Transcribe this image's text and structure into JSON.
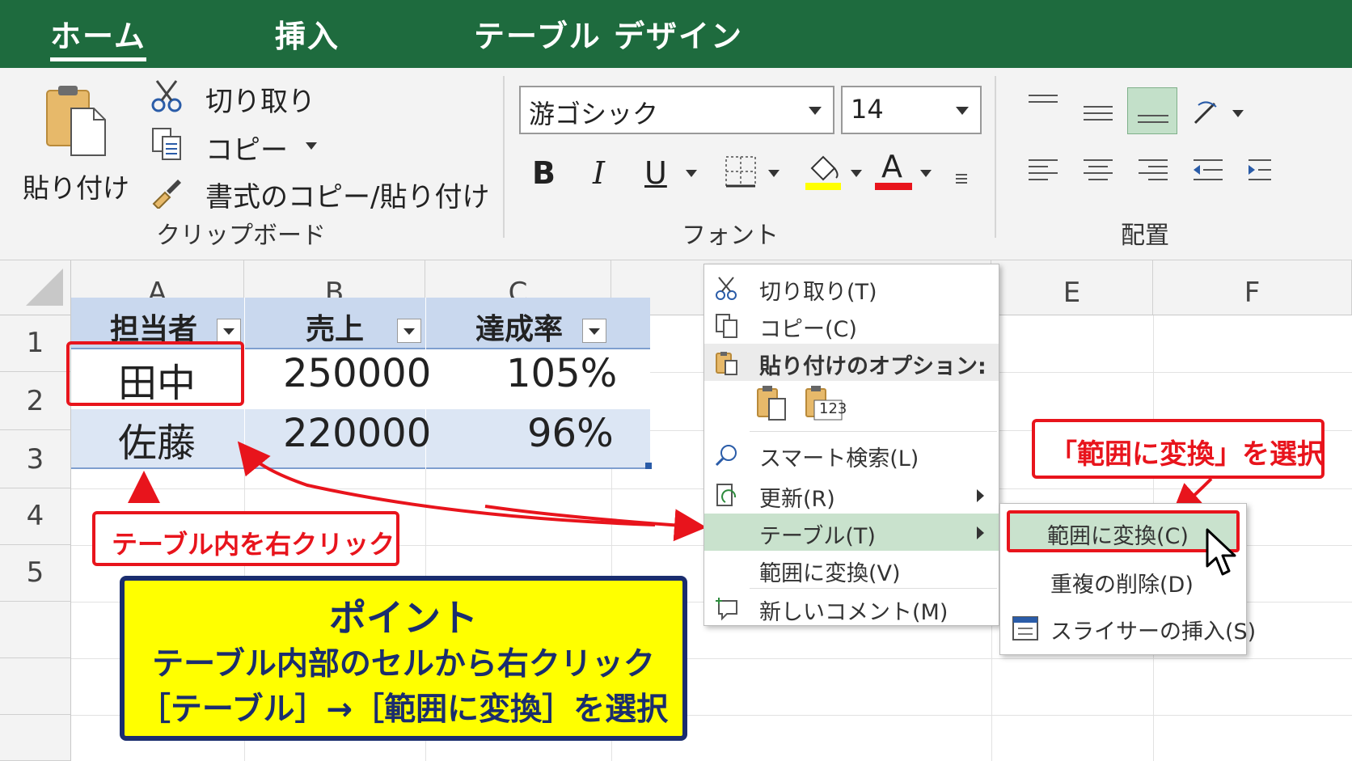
{
  "tabs": [
    {
      "label": "ホーム",
      "active": true
    },
    {
      "label": "挿入",
      "active": false
    },
    {
      "label": "テーブル デザイン",
      "active": false
    }
  ],
  "ribbon": {
    "clipboard": {
      "paste_label": "貼り付け",
      "cut_label": "切り取り",
      "copy_label": "コピー",
      "format_painter_label": "書式のコピー/貼り付け",
      "group_label": "クリップボード"
    },
    "font": {
      "font_name": "游ゴシック",
      "font_size": "14",
      "bold": "B",
      "italic": "I",
      "underline": "U",
      "font_color_glyph": "A",
      "group_label": "フォント",
      "highlight_color": "#ffff00",
      "font_color": "#e8141c"
    },
    "alignment": {
      "group_label": "配置"
    }
  },
  "sheet": {
    "columns": [
      "A",
      "B",
      "C",
      "",
      "E",
      "F"
    ],
    "rows": [
      "1",
      "2",
      "3",
      "4",
      "5"
    ],
    "table_headers": [
      "担当者",
      "売上",
      "達成率"
    ],
    "table_rows": [
      [
        "田中",
        "250000",
        "105%"
      ],
      [
        "佐藤",
        "220000",
        "96%"
      ]
    ],
    "table_header_color": "#c9d8ee",
    "table_band_color": "#dce6f4"
  },
  "context_menu": {
    "items": [
      {
        "label": "切り取り(T)",
        "icon": "scissors-icon"
      },
      {
        "label": "コピー(C)",
        "icon": "copy-icon"
      },
      {
        "label": "貼り付けのオプション:",
        "icon": "paste-icon",
        "header": true
      },
      {
        "label": "スマート検索(L)",
        "icon": "smart-lookup-icon"
      },
      {
        "label": "更新(R)",
        "icon": "refresh-icon",
        "submenu": true
      },
      {
        "label": "テーブル(T)",
        "icon": "",
        "submenu": true,
        "highlighted": true
      },
      {
        "label": "範囲に変換(V)",
        "icon": ""
      },
      {
        "label": "新しいコメント(M)",
        "icon": "new-comment-icon"
      }
    ],
    "paste_option_values": "123"
  },
  "submenu": {
    "items": [
      {
        "label": "範囲に変換(C)",
        "highlighted": true
      },
      {
        "label": "重複の削除(D)"
      },
      {
        "label": "スライサーの挿入(S)"
      }
    ]
  },
  "annotations": {
    "select_callout": "「範囲に変換」を選択",
    "right_click_callout": "テーブル内を右クリック",
    "point_title": "ポイント",
    "point_line1": "テーブル内部のセルから右クリック",
    "point_line2": "［テーブル］→［範囲に変換］を選択",
    "callout_color": "#e8141c",
    "point_bg": "#ffff00",
    "point_border": "#1a2d6e"
  }
}
